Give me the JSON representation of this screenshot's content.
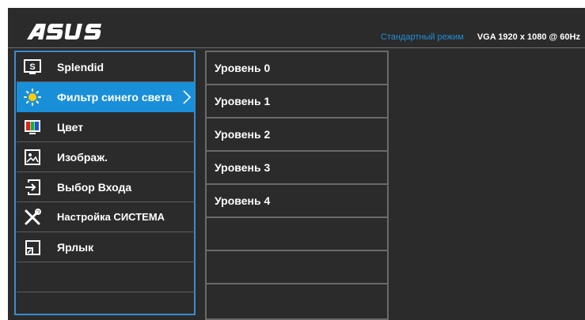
{
  "header": {
    "logo": "ASUS",
    "mode": "Стандартный режим",
    "signal": "VGA 1920 x 1080 @ 60Hz"
  },
  "menu": {
    "items": [
      {
        "label": "Splendid",
        "icon": "splendid-icon"
      },
      {
        "label": "Фильтр синего света",
        "icon": "blue-light-icon",
        "selected": true
      },
      {
        "label": "Цвет",
        "icon": "color-icon"
      },
      {
        "label": "Изображ.",
        "icon": "image-icon"
      },
      {
        "label": "Выбор Входа",
        "icon": "input-select-icon"
      },
      {
        "label": "Настройка СИСТЕМА",
        "icon": "system-setup-icon"
      },
      {
        "label": "Ярлык",
        "icon": "shortcut-icon"
      }
    ]
  },
  "submenu": {
    "items": [
      {
        "label": "Уровень 0"
      },
      {
        "label": "Уровень 1"
      },
      {
        "label": "Уровень 2"
      },
      {
        "label": "Уровень 3"
      },
      {
        "label": "Уровень 4"
      }
    ]
  },
  "colors": {
    "background": "#2b2b2b",
    "accent": "#1a8fd9",
    "menu_border": "#3d8ad0",
    "status_mode": "#1f8ed8"
  }
}
